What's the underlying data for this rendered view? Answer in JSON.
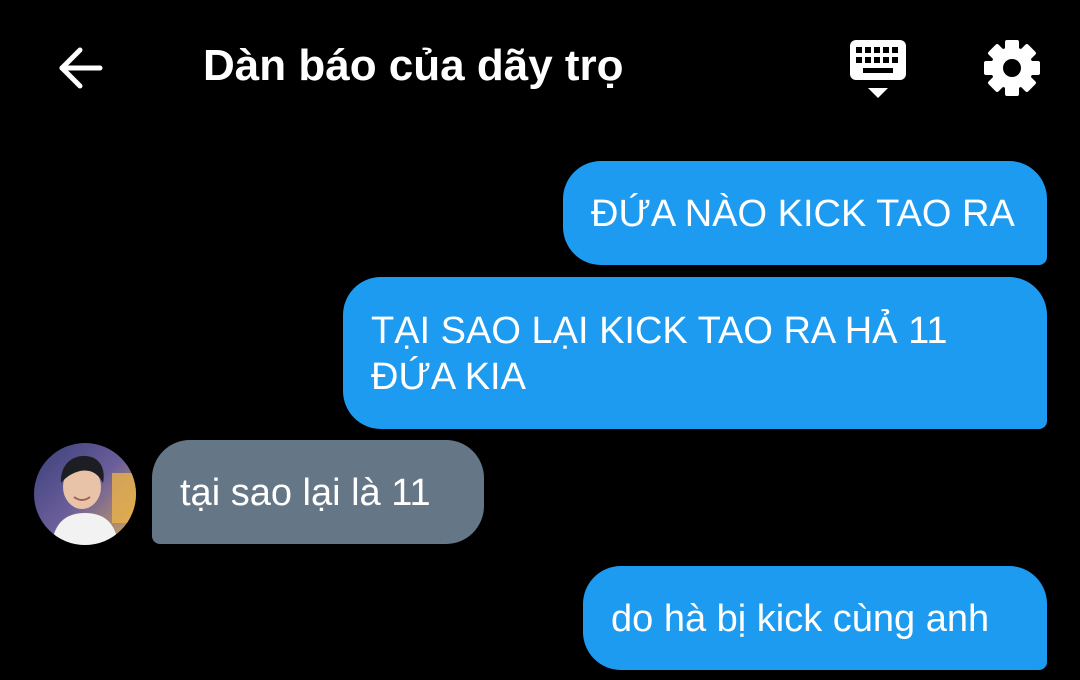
{
  "header": {
    "title": "Dàn báo của dãy trọ",
    "icons": {
      "back": "back-arrow-icon",
      "keyboard": "keyboard-icon",
      "settings": "gear-icon"
    }
  },
  "messages": [
    {
      "direction": "out",
      "text": "ĐỨA NÀO KICK TAO RA"
    },
    {
      "direction": "out",
      "text": "TẠI SAO LẠI KICK TAO RA HẢ 11 ĐỨA KIA"
    },
    {
      "direction": "in",
      "text": "tại sao lại là 11"
    },
    {
      "direction": "out",
      "text": "do hà bị kick cùng anh"
    }
  ],
  "colors": {
    "background": "#000000",
    "outgoing_bubble": "#1d9bf0",
    "incoming_bubble": "#657786",
    "text": "#ffffff"
  }
}
